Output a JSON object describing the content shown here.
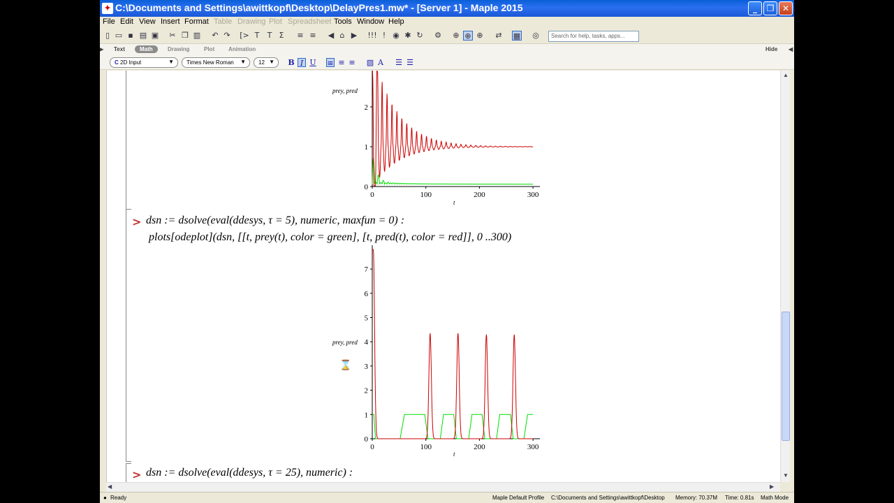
{
  "window": {
    "title": "C:\\Documents and Settings\\awittkopf\\Desktop\\DelayPres1.mw* - [Server 1] - Maple 2015",
    "app_icon": "maple-leaf-icon",
    "controls": [
      "minimize",
      "maximize",
      "close"
    ]
  },
  "menubar": {
    "items": [
      {
        "label": "File",
        "enabled": true
      },
      {
        "label": "Edit",
        "enabled": true
      },
      {
        "label": "View",
        "enabled": true
      },
      {
        "label": "Insert",
        "enabled": true
      },
      {
        "label": "Format",
        "enabled": true
      },
      {
        "label": "Table",
        "enabled": false
      },
      {
        "label": "Drawing",
        "enabled": false
      },
      {
        "label": "Plot",
        "enabled": false
      },
      {
        "label": "Spreadsheet",
        "enabled": false
      },
      {
        "label": "Tools",
        "enabled": true
      },
      {
        "label": "Window",
        "enabled": true
      },
      {
        "label": "Help",
        "enabled": true
      }
    ]
  },
  "toolbar": {
    "search_placeholder": "Search for help, tasks, apps..."
  },
  "palette_tabs": {
    "items": [
      "Text",
      "Math",
      "Drawing",
      "Plot",
      "Animation"
    ],
    "active": "Math",
    "hide_label": "Hide"
  },
  "formatbar": {
    "input_mode": "2D Input",
    "font": "Times New Roman",
    "size": "12",
    "bold": "B",
    "italic": "I",
    "underline": "U"
  },
  "document": {
    "plot1": {
      "ylabel": "prey, pred",
      "xlabel": "t",
      "y_ticks": [
        "0",
        "1",
        "2"
      ],
      "x_ticks": [
        "0",
        "100",
        "200",
        "300"
      ]
    },
    "command1": {
      "prompt": ">",
      "line1": "dsn := dsolve(eval(ddesys, τ = 5), numeric, maxfun = 0) :",
      "line2": "plots[odeplot](dsn, [[t, prey(t), color = green], [t, pred(t), color = red]], 0 ..300)"
    },
    "plot2": {
      "ylabel": "prey, pred",
      "xlabel": "t",
      "y_ticks": [
        "0",
        "1",
        "2",
        "3",
        "4",
        "5",
        "6",
        "7"
      ],
      "x_ticks": [
        "0",
        "100",
        "200",
        "300"
      ]
    },
    "command2": {
      "prompt": ">",
      "line1": "dsn := dsolve(eval(ddesys, τ = 25), numeric) :"
    }
  },
  "statusbar": {
    "state": "Ready",
    "profile": "Maple Default Profile",
    "path": "C:\\Documents and Settings\\awittkopf\\Desktop",
    "memory": "Memory: 70.37M",
    "time": "Time: 0.81s",
    "mode": "Math Mode"
  },
  "colors": {
    "pred": "#cc0000",
    "prey": "#00dd00",
    "prompt": "#c03030"
  }
}
